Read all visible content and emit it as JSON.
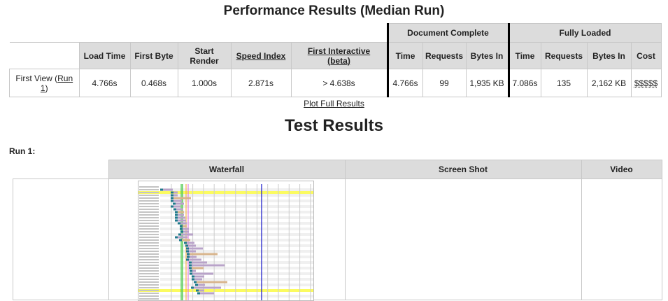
{
  "title": "Performance Results (Median Run)",
  "perf": {
    "group_doc": "Document Complete",
    "group_full": "Fully Loaded",
    "headers": {
      "load_time": "Load Time",
      "first_byte": "First Byte",
      "start_render": "Start Render",
      "speed_index": "Speed Index",
      "first_interactive": "First Interactive",
      "beta": "(beta)",
      "time": "Time",
      "requests": "Requests",
      "bytes_in": "Bytes In",
      "cost": "Cost"
    },
    "row": {
      "label": "First View (",
      "run_link": "Run 1",
      ")": ")",
      "close": ")",
      "load_time": "4.766s",
      "first_byte": "0.468s",
      "start_render": "1.000s",
      "speed_index": "2.871s",
      "first_interactive": "> 4.638s",
      "doc_time": "4.766s",
      "doc_requests": "99",
      "doc_bytes": "1,935 KB",
      "full_time": "7.086s",
      "full_requests": "135",
      "full_bytes": "2,162 KB",
      "cost": "$$$$$"
    }
  },
  "plot_link": "Plot Full Results",
  "test_results_title": "Test Results",
  "run_label": "Run 1:",
  "results_headers": {
    "waterfall": "Waterfall",
    "screenshot": "Screen Shot",
    "video": "Video"
  }
}
